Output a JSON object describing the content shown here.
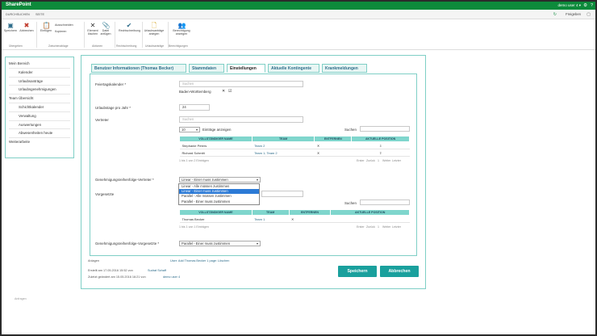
{
  "suitebar": {
    "brand": "SharePoint",
    "user": "demo user 4 ▾"
  },
  "tabbar": {
    "tab1": "DURCHSUCHEN",
    "tab2": "SEITE",
    "share": "Freigeben"
  },
  "ribbon": {
    "buttons": {
      "save": "Speichern",
      "cancel": "Abbrechen",
      "paste": "Einfügen",
      "delete": "Element löschen",
      "edit": "Datei anfügen",
      "approve": "Rechtschreibung",
      "vacation_edit": "Urlaubsanträge anlegen",
      "permissions": "Berechtigung anzeigen"
    },
    "small": {
      "cut": "Ausschneiden",
      "copy": "Kopieren"
    },
    "groups": {
      "commit": "Übergeben",
      "clipboard": "Zwischenablage",
      "actions": "Aktionen",
      "spelling": "Rechtschreibung",
      "vacation": "Urlaubsanträge",
      "perms": "Berechtigungen"
    }
  },
  "leftnav": {
    "items": [
      {
        "label": "Mein Bereich",
        "sub": false
      },
      {
        "label": "Kalender",
        "sub": true
      },
      {
        "label": "Urlaubsanträge",
        "sub": true
      },
      {
        "label": "Urlaubsgenehmigungen",
        "sub": true
      },
      {
        "label": "Team Übersicht",
        "sub": false
      },
      {
        "label": "Schichtkalender",
        "sub": true
      },
      {
        "label": "Verwaltung",
        "sub": true
      },
      {
        "label": "Auswertungen",
        "sub": true
      },
      {
        "label": "Abwesenheiten heute",
        "sub": true
      },
      {
        "label": "Weiterarbeite",
        "sub": false
      }
    ]
  },
  "tabs": {
    "t1": "Benutzer Informationen (Thomas Becker)",
    "t2": "Stammdaten",
    "t3": "Einstellungen",
    "t4": "Aktuelle Kontingente",
    "t5": "Krankmeldungen"
  },
  "form": {
    "holiday_label": "Feiertagskalender *",
    "holiday_placeholder": "Suchen",
    "holiday_value": "Baden-Württemberg",
    "vacation_days_label": "Urlaubstage pro Jahr *",
    "vacation_days_value": "24",
    "deputy_label": "Vertreter",
    "deputy_placeholder": "Suchen",
    "entries_value": "10",
    "entries_label": "Einträge anzeigen",
    "search_label": "Suchen",
    "columns": {
      "name": "VOLLSTÄNDIGER NAME",
      "team": "TEAM",
      "remove": "ENTFERNEN",
      "position": "AKTUELLE POSITION"
    },
    "deputy_rows": [
      {
        "name": "Stephanie Peters",
        "team": "Team 2"
      },
      {
        "name": "Richard Schmitt",
        "team": "Team 1; Team 2"
      }
    ],
    "deputy_info": "1 bis 1 von 2 Einträgen",
    "pager": {
      "first": "Erster",
      "prev": "Zurück",
      "page": "1",
      "next": "Weiter",
      "last": "Letzter"
    },
    "approval_label": "Genehmigungsreihenfolge-Vertreter *",
    "approval_value": "Linear - Einer muss zustimmen",
    "approval_options": [
      "Linear - Alle müssen zustimmen",
      "Linear - Einer muss zustimmen",
      "Parallel - Alle müssen zustimmen",
      "Parallel - Einer muss zustimmen"
    ],
    "approval_selected_index": 1,
    "superior_label": "Vorgesetzte",
    "superior_search": "Suchen",
    "superior_rows": [
      {
        "name": "Thomas Becker",
        "team": "Team 1"
      }
    ],
    "superior_info": "1 bis 1 von 1 Einträgen",
    "superior_approval_label": "Genehmigungsreihenfolge-Vorgesetzte *",
    "superior_approval_value": "Parallel - Einer muss zustimmen",
    "attachments_label": "Anlagen",
    "attachments_link": "User: Add Thomas Becker 1 page: Löschen",
    "created": "Erstellt am 17.05.2016 15:52 von",
    "created_by": "Sudrat Schaff",
    "modified": "Zuletzt geändert am 15.05.2016 16:21 von",
    "modified_by": "demo user 4"
  },
  "actions": {
    "save": "Speichern",
    "cancel": "Abbrechen"
  },
  "footer_note": "Anfragen"
}
